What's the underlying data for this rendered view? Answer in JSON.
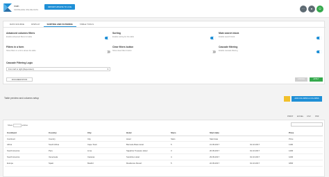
{
  "app": {
    "title": "main",
    "subtitle": "SKINSHADE ONLINE DATA",
    "publish_label": "IMPORT/UPDATE TO LIVE",
    "colors": {
      "accent": "#1e8fd6",
      "green": "#35a94d",
      "yellow": "#f1c02b"
    }
  },
  "header_actions": [
    {
      "icon": "grid-icon",
      "glyph": "⋯",
      "color": "#5e6b73"
    },
    {
      "icon": "user-avatar-icon",
      "glyph": "●",
      "color": "#5e6b73"
    },
    {
      "icon": "power-icon",
      "glyph": "⏻",
      "color": "#35a94d"
    }
  ],
  "tabs": [
    "DATA SOURCE",
    "DISPLAY",
    "SORTING AND FILTERING",
    "TABLE TOOLS"
  ],
  "active_tab": 2,
  "options": [
    {
      "title": "Advanced columns filters",
      "desc": "Enable advanced filters for table",
      "on": true
    },
    {
      "title": "Sorting",
      "desc": "Enable sorting for the table",
      "on": true
    },
    {
      "title": "Main search block",
      "desc": "Enable search block",
      "on": true
    },
    {
      "title": "Filters in a form",
      "desc": "Show filters in a form above the table",
      "on": false
    },
    {
      "title": "Clear filters button",
      "desc": "Show clear filters button",
      "on": false
    },
    {
      "title": "Cascade filtering",
      "desc": "Enable cascade filtering",
      "on": true
    }
  ],
  "cascade_logic": {
    "label": "Cascade Filtering Logic",
    "value": "From left to right (Dependent)",
    "caret": "▾"
  },
  "documentation_label": "DOCUMENTATION",
  "cancel_label": "CANCEL",
  "apply_label": "APPLY",
  "preview": {
    "title": "Table preview and columns setup",
    "add_button": "ADD COLUMNS & COLUMNS",
    "exports": [
      "PRINT",
      "EXCEL",
      "CSV",
      "PDF"
    ],
    "length_label_pre": "Show",
    "length_label_post": "entries",
    "columns": [
      "Continent",
      "Country",
      "City",
      "Hotel",
      "Stars",
      "Start date",
      "Price"
    ],
    "filter_row": [
      "Continent",
      "Country",
      "City",
      "Hotel",
      "Stars",
      "Start date",
      "Price"
    ],
    "rows": [
      [
        "Africa",
        "South Africa",
        "Cape Town",
        "Bernede Bass Hotel",
        "5",
        "21.09.2017",
        "01.10.2017",
        "1100"
      ],
      [
        "South America",
        "Peru",
        "Lima",
        "Sapphire Treasure Hotel",
        "3",
        "20.09.2017",
        "01.10.2017",
        "1400"
      ],
      [
        "South America",
        "Venezuela",
        "Caracas",
        "Sunshine Hotel",
        "4",
        "29.09.2017",
        "01.10.2017",
        "1200"
      ],
      [
        "Europe",
        "Spain",
        "Madrid",
        "Residence Resort",
        "5",
        "22.09.2017",
        "01.10.2017",
        "1800"
      ]
    ]
  }
}
